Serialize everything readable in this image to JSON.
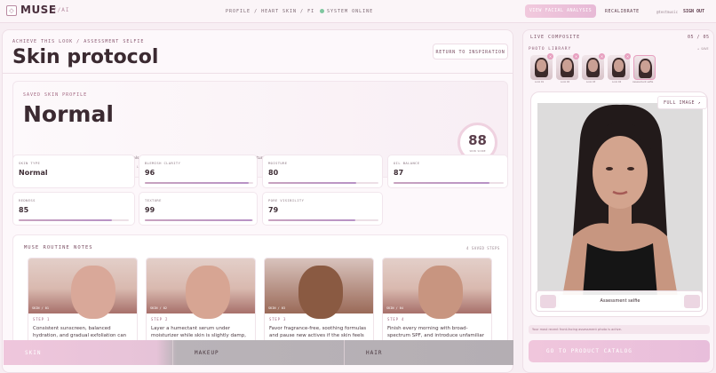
{
  "header": {
    "logo": "MUSE",
    "logo_sub": "//AI",
    "nav": [
      "PROFILE / HEART",
      "SKIN / FI",
      "SYSTEM ONLINE"
    ],
    "btn_facial": "VIEW FACIAL ANALYSIS",
    "btn_recal": "RECALIBRATE",
    "user": "@testmusic",
    "signout": "SIGN OUT"
  },
  "main": {
    "kicker": "ACHIEVE THIS LOOK / ASSESSMENT SELFIE",
    "title": "Skin protocol",
    "return_btn": "RETURN TO INSPIRATION"
  },
  "profile": {
    "kicker": "SAVED SKIN PROFILE",
    "type": "Normal",
    "desc": "YouCam reads your skin as Normal. Your strongest signals are texture and blemish clarity. The clearest routine opportunities are pore visibility and moisture.",
    "foot": "ORIGINAL ASSESSMENT SELFIE · SAVED ACROSS EVERY LOOK UNTIL RECALIBRATION",
    "score": "88",
    "score_label": "SKIN SCORE"
  },
  "metrics": [
    {
      "label": "SKIN TYPE",
      "value": "Normal",
      "level": null
    },
    {
      "label": "BLEMISH CLARITY",
      "value": "96",
      "level": 96
    },
    {
      "label": "MOISTURE",
      "value": "80",
      "level": 80
    },
    {
      "label": "OIL BALANCE",
      "value": "87",
      "level": 87
    },
    {
      "label": "REDNESS",
      "value": "85",
      "level": 85
    },
    {
      "label": "TEXTURE",
      "value": "99",
      "level": 99
    },
    {
      "label": "PORE VISIBILITY",
      "value": "79",
      "level": 79
    }
  ],
  "notes": {
    "title": "MUSE ROUTINE NOTES",
    "count": "4 SAVED STEPS",
    "steps": [
      {
        "tag": "SKIN / 01",
        "n": "STEP 1",
        "text": "Consistent sunscreen, balanced hydration, and gradual exfoliation can"
      },
      {
        "tag": "SKIN / 02",
        "n": "STEP 2",
        "text": "Layer a humectant serum under moisturizer while skin is slightly damp,"
      },
      {
        "tag": "SKIN / 03",
        "n": "STEP 3",
        "text": "Favor fragrance-free, soothing formulas and pause new actives if the skin feels"
      },
      {
        "tag": "SKIN / 04",
        "n": "STEP 4",
        "text": "Finish every morning with broad-spectrum SPF, and introduce unfamiliar"
      }
    ]
  },
  "tabs": [
    "SKIN",
    "MAKEUP",
    "HAIR"
  ],
  "right": {
    "kicker": "LIVE COMPOSITE",
    "count": "05 / 05",
    "library": "PHOTO LIBRARY",
    "add": "+ SAVE",
    "thumbs": [
      "Look 01",
      "Look 02",
      "Look 03",
      "Look 04",
      "Assessment selfie"
    ],
    "full_btn": "FULL IMAGE ↗",
    "caption": "Assessment selfie",
    "note": "Your most recent front-facing assessment photo is active.",
    "catalog": "GO TO PRODUCT CATALOG"
  }
}
